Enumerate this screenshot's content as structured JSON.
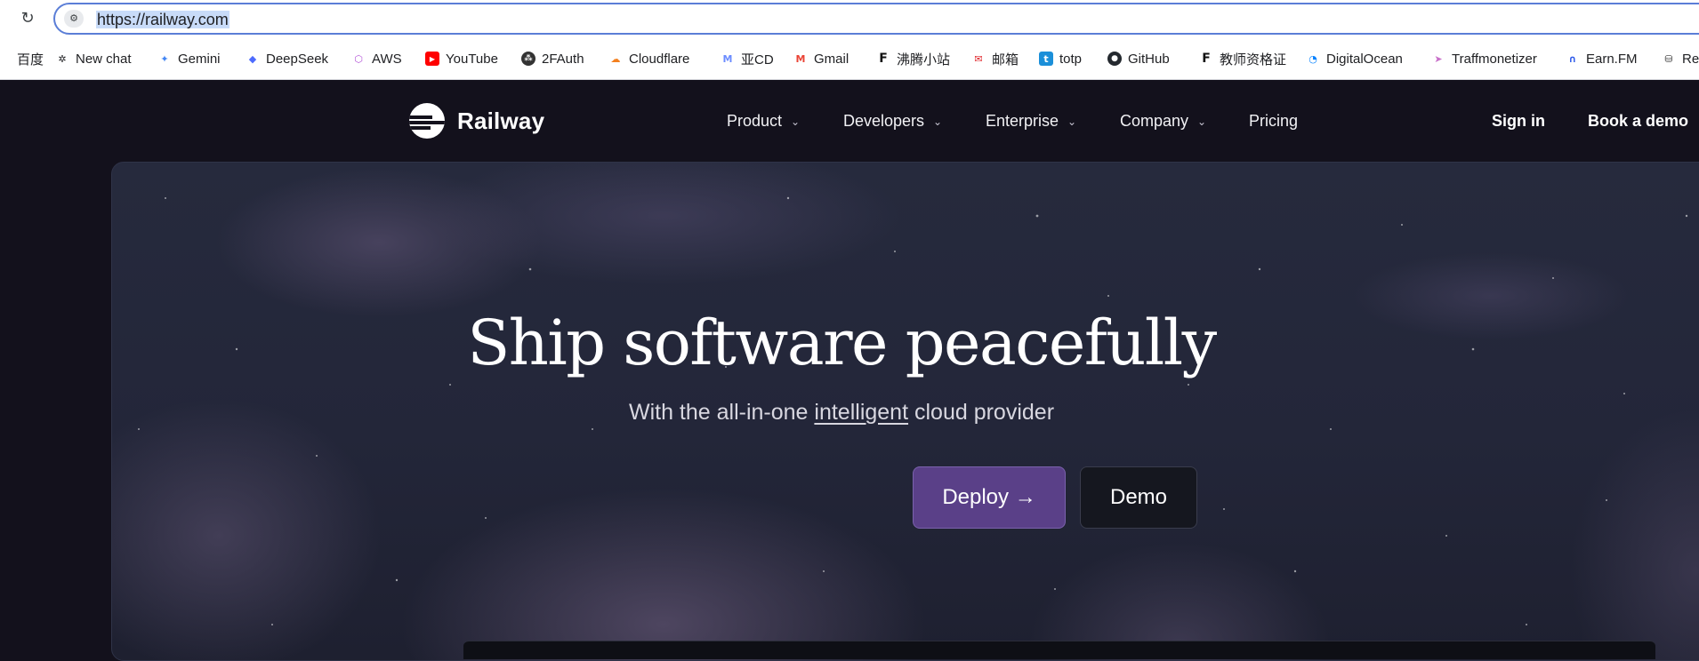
{
  "browser": {
    "reload_icon": "reload-icon",
    "url": "https://railway.com",
    "bookmarks": [
      {
        "label": "百度",
        "icon": "baidu-icon",
        "color": "#2932e1"
      },
      {
        "label": "New chat",
        "icon": "openai-icon",
        "color": "#202124"
      },
      {
        "label": "Gemini",
        "icon": "gemini-icon",
        "color": "#4285f4"
      },
      {
        "label": "DeepSeek",
        "icon": "deepseek-icon",
        "color": "#4d6bfe"
      },
      {
        "label": "AWS",
        "icon": "aws-icon",
        "color": "#b455d8"
      },
      {
        "label": "YouTube",
        "icon": "youtube-icon",
        "color": "#ff0000"
      },
      {
        "label": "2FAuth",
        "icon": "2fauth-icon",
        "color": "#333333"
      },
      {
        "label": "Cloudflare",
        "icon": "cloudflare-icon",
        "color": "#f38020"
      },
      {
        "label": "亚CD",
        "icon": "mail-icon",
        "color": "#6b8cff"
      },
      {
        "label": "Gmail",
        "icon": "gmail-icon",
        "color": "#ea4335"
      },
      {
        "label": "沸腾小站",
        "icon": "f-icon",
        "color": "#111111"
      },
      {
        "label": "邮箱",
        "icon": "mailbox-icon",
        "color": "#e0262b"
      },
      {
        "label": "totp",
        "icon": "totp-icon",
        "color": "#1b8fd9"
      },
      {
        "label": "GitHub",
        "icon": "github-icon",
        "color": "#24292f"
      },
      {
        "label": "教师资格证",
        "icon": "f-icon",
        "color": "#111111"
      },
      {
        "label": "DigitalOcean",
        "icon": "digitalocean-icon",
        "color": "#0080ff"
      },
      {
        "label": "Traffmonetizer",
        "icon": "traffmonetizer-icon",
        "color": "#c86fc9"
      },
      {
        "label": "Earn.FM",
        "icon": "earnfm-icon",
        "color": "#2f5bea"
      },
      {
        "label": "Re",
        "icon": "database-icon",
        "color": "#333333"
      }
    ]
  },
  "site": {
    "brand": "Railway",
    "nav": {
      "product": "Product",
      "developers": "Developers",
      "enterprise": "Enterprise",
      "company": "Company",
      "pricing": "Pricing"
    },
    "sign_in": "Sign in",
    "book_demo": "Book a demo"
  },
  "hero": {
    "headline": "Ship software peacefully",
    "subline_before": "With the all-in-one ",
    "subline_link": "intelligent",
    "subline_after": " cloud provider",
    "deploy_button": "Deploy →",
    "demo_button": "Demo"
  },
  "colors": {
    "page_bg": "#13111c",
    "deploy_button": "#5a4088",
    "demo_button": "#15171f"
  }
}
